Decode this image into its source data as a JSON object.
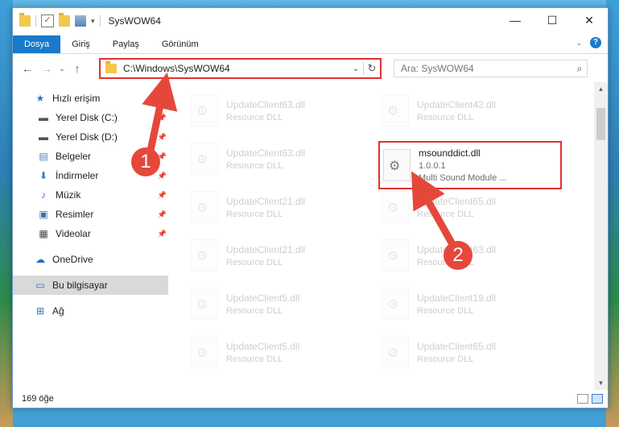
{
  "window": {
    "title": "SysWOW64",
    "controls": {
      "minimize": "—",
      "maximize": "☐",
      "close": "✕"
    }
  },
  "ribbon": {
    "tabs": [
      "Dosya",
      "Giriş",
      "Paylaş",
      "Görünüm"
    ],
    "active_tab": "Dosya",
    "accent": "#1979ca"
  },
  "address": {
    "path": "C:\\Windows\\SysWOW64",
    "search_placeholder": "Ara: SysWOW64"
  },
  "nav": {
    "quick_access": "Hızlı erişim",
    "items": [
      {
        "label": "Yerel Disk (C:)",
        "icon": "drive-icon",
        "pinned": true
      },
      {
        "label": "Yerel Disk (D:)",
        "icon": "drive-icon",
        "pinned": true
      },
      {
        "label": "Belgeler",
        "icon": "documents-icon",
        "pinned": true
      },
      {
        "label": "İndirmeler",
        "icon": "downloads-icon",
        "pinned": true
      },
      {
        "label": "Müzik",
        "icon": "music-icon",
        "pinned": true
      },
      {
        "label": "Resimler",
        "icon": "pictures-icon",
        "pinned": true
      },
      {
        "label": "Videolar",
        "icon": "videos-icon",
        "pinned": true
      }
    ],
    "onedrive": "OneDrive",
    "this_pc": "Bu bilgisayar",
    "network": "Ağ"
  },
  "files": [
    {
      "name": "UpdateClient63.dll",
      "desc": "Resource DLL",
      "faded": true
    },
    {
      "name": "UpdateClient42.dll",
      "desc": "Resource DLL",
      "faded": true
    },
    {
      "name": "UpdateClient63.dll",
      "desc": "Resource DLL",
      "faded": true
    },
    {
      "name": "msounddict.dll",
      "version": "1.0.0.1",
      "desc": "Multi Sound Module ...",
      "faded": false
    },
    {
      "name": "UpdateClient21.dll",
      "desc": "Resource DLL",
      "faded": true
    },
    {
      "name": "UpdateClient65.dll",
      "desc": "Resource DLL",
      "faded": true
    },
    {
      "name": "UpdateClient21.dll",
      "desc": "Resource DLL",
      "faded": true
    },
    {
      "name": "UpdateClient63.dll",
      "desc": "Resource DLL",
      "faded": true
    },
    {
      "name": "UpdateClient5.dll",
      "desc": "Resource DLL",
      "faded": true
    },
    {
      "name": "UpdateClient19.dll",
      "desc": "Resource DLL",
      "faded": true
    },
    {
      "name": "UpdateClient5.dll",
      "desc": "Resource DLL",
      "faded": true
    },
    {
      "name": "UpdateClient65.dll",
      "desc": "Resource DLL",
      "faded": true
    }
  ],
  "status": {
    "count": "169 öğe"
  },
  "annotations": {
    "step1": "1",
    "step2": "2",
    "color": "#e5483b"
  }
}
